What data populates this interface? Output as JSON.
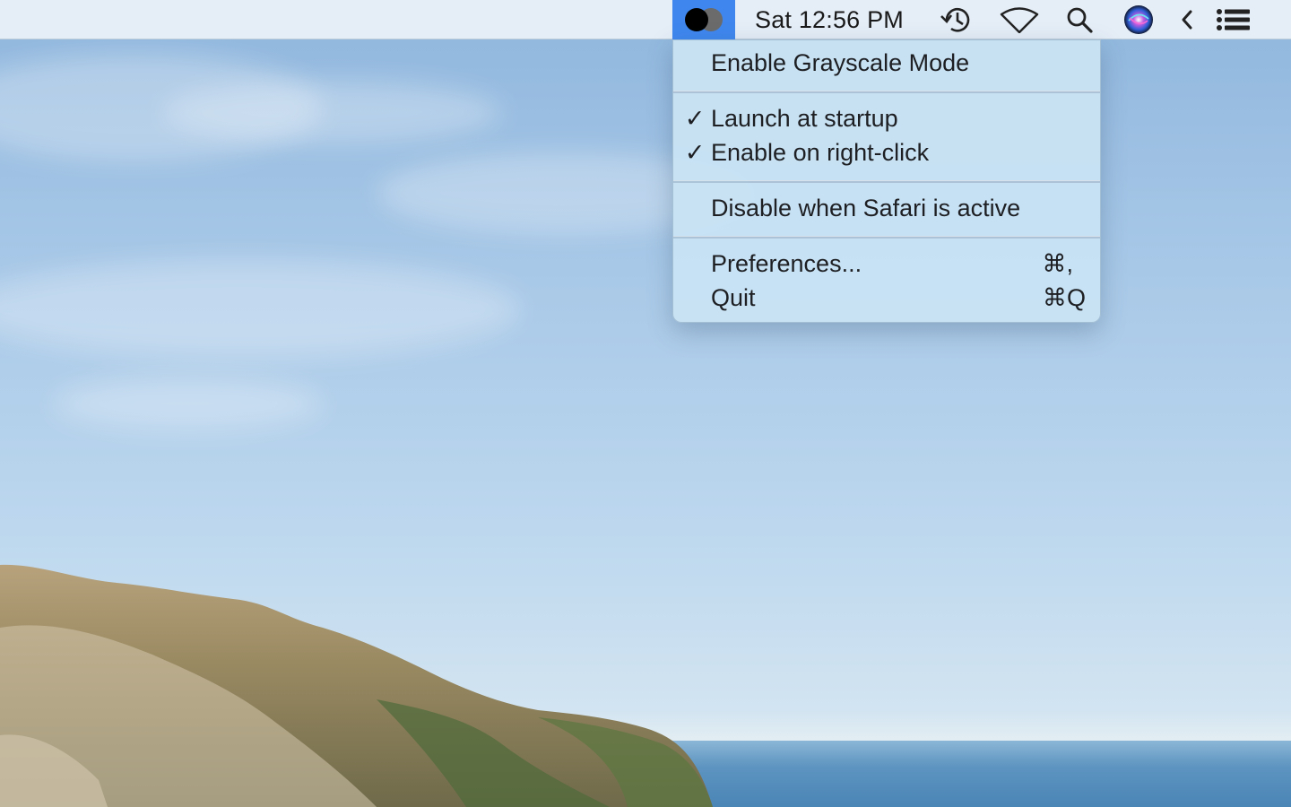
{
  "menubar": {
    "clock": "Sat 12:56 PM",
    "icons": [
      "grayscale-toggle-icon",
      "time-machine-icon",
      "wifi-icon",
      "spotlight-search-icon",
      "siri-icon",
      "chevron-left-icon",
      "notification-center-icon"
    ],
    "accent": "#3f87ee"
  },
  "menu": {
    "items": [
      {
        "label": "Enable Grayscale Mode",
        "checked": false,
        "shortcut": ""
      },
      {
        "label": "Launch at startup",
        "checked": true,
        "shortcut": ""
      },
      {
        "label": "Enable on right-click",
        "checked": true,
        "shortcut": ""
      },
      {
        "label": "Disable when Safari is active",
        "checked": false,
        "shortcut": ""
      },
      {
        "label": "Preferences...",
        "checked": false,
        "shortcut": "⌘,"
      },
      {
        "label": "Quit",
        "checked": false,
        "shortcut": "⌘Q"
      }
    ],
    "check_glyph": "✓"
  }
}
